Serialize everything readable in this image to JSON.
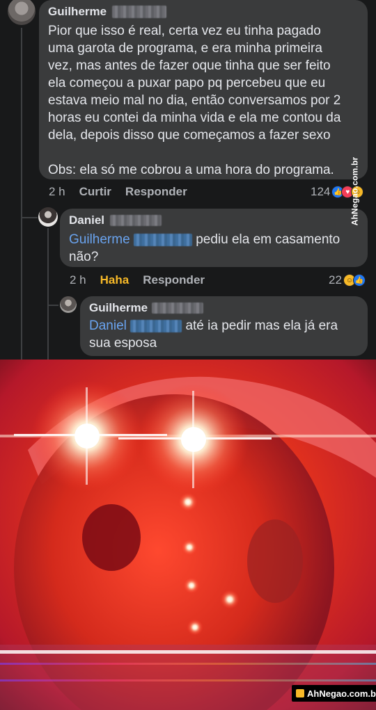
{
  "comment": {
    "author": "Guilherme",
    "text_lines": [
      "Pior que isso é real, certa vez eu tinha pagado",
      "uma garota de programa, e era minha primeira",
      "vez, mas antes de fazer oque tinha que ser feito",
      "ela começou a puxar papo pq percebeu que eu",
      "estava meio mal no dia, então conversamos por 2",
      "horas eu contei da minha vida e ela me contou da",
      "dela, depois disso que começamos a fazer sexo"
    ],
    "text_extra": "Obs: ela só me cobrou a uma hora do programa.",
    "time": "2 h",
    "like_label": "Curtir",
    "reply_label": "Responder",
    "reaction_count": "124"
  },
  "reply1": {
    "author": "Daniel",
    "mention": "Guilherme",
    "text_line1": "pediu ela em casamento",
    "text_line2": "não?",
    "time": "2 h",
    "reaction_label": "Haha",
    "reply_label": "Responder",
    "reaction_count": "22"
  },
  "reply2": {
    "author": "Guilherme",
    "mention": "Daniel",
    "text_line1": "até ia pedir mas ela já era",
    "text_line2": "sua esposa"
  },
  "watermarks": {
    "side": "AhNegao.com.br",
    "bottom": "AhNegao.com.br"
  },
  "colors": {
    "background": "#18191a",
    "bubble": "#3a3b3c",
    "text": "#e4e6eb",
    "secondary": "#b0b3b8",
    "mention": "#6aa4f0",
    "haha": "#f7b928",
    "like_blue": "#2078f4"
  },
  "icons": [
    "avatar",
    "like-reaction-icon",
    "love-reaction-icon",
    "haha-reaction-icon",
    "meme-glowing-eyes-image",
    "ahnegao-logo-icon"
  ]
}
